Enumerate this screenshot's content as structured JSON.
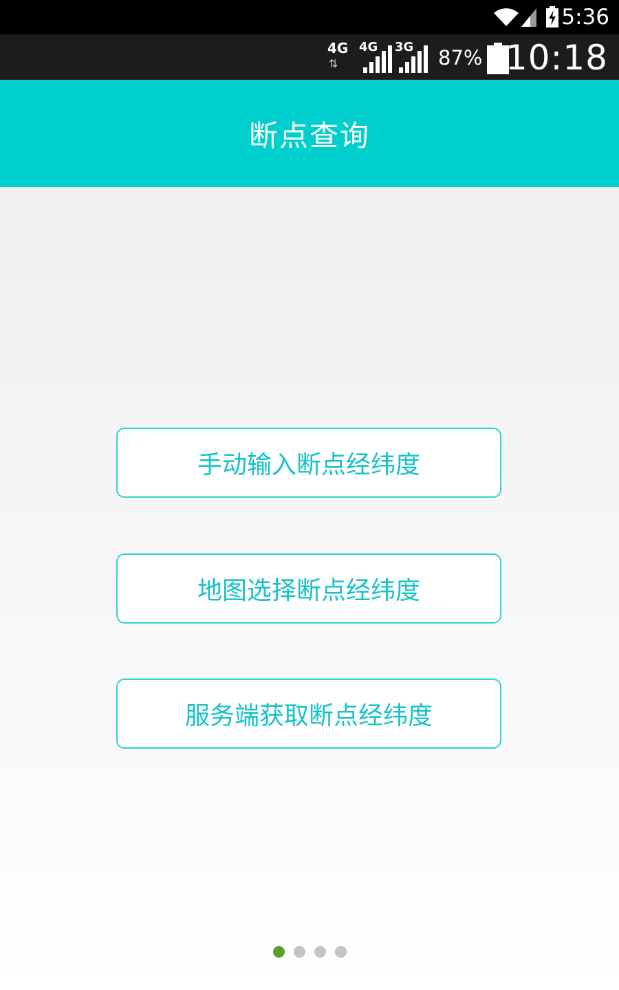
{
  "device_status_bar": {
    "time": "5:36",
    "icons": [
      "wifi-icon",
      "cell-signal-icon",
      "battery-charging-icon"
    ]
  },
  "app_status_bar": {
    "network_type_1": "4G",
    "network_type_2": "4G",
    "network_type_3": "3G",
    "battery_percent": "87%",
    "clock": "10:18"
  },
  "header": {
    "title": "断点查询",
    "background_color": "#00d0cd"
  },
  "options": [
    {
      "label": "手动输入断点经纬度"
    },
    {
      "label": "地图选择断点经纬度"
    },
    {
      "label": "服务端获取断点经纬度"
    }
  ],
  "page_indicator": {
    "total": 4,
    "active_index": 0,
    "active_color": "#5a9e33",
    "inactive_color": "#c4c4c4"
  },
  "colors": {
    "accent": "#00d0cd",
    "button_text": "#16c2c6",
    "button_border": "#2fd2d0"
  }
}
